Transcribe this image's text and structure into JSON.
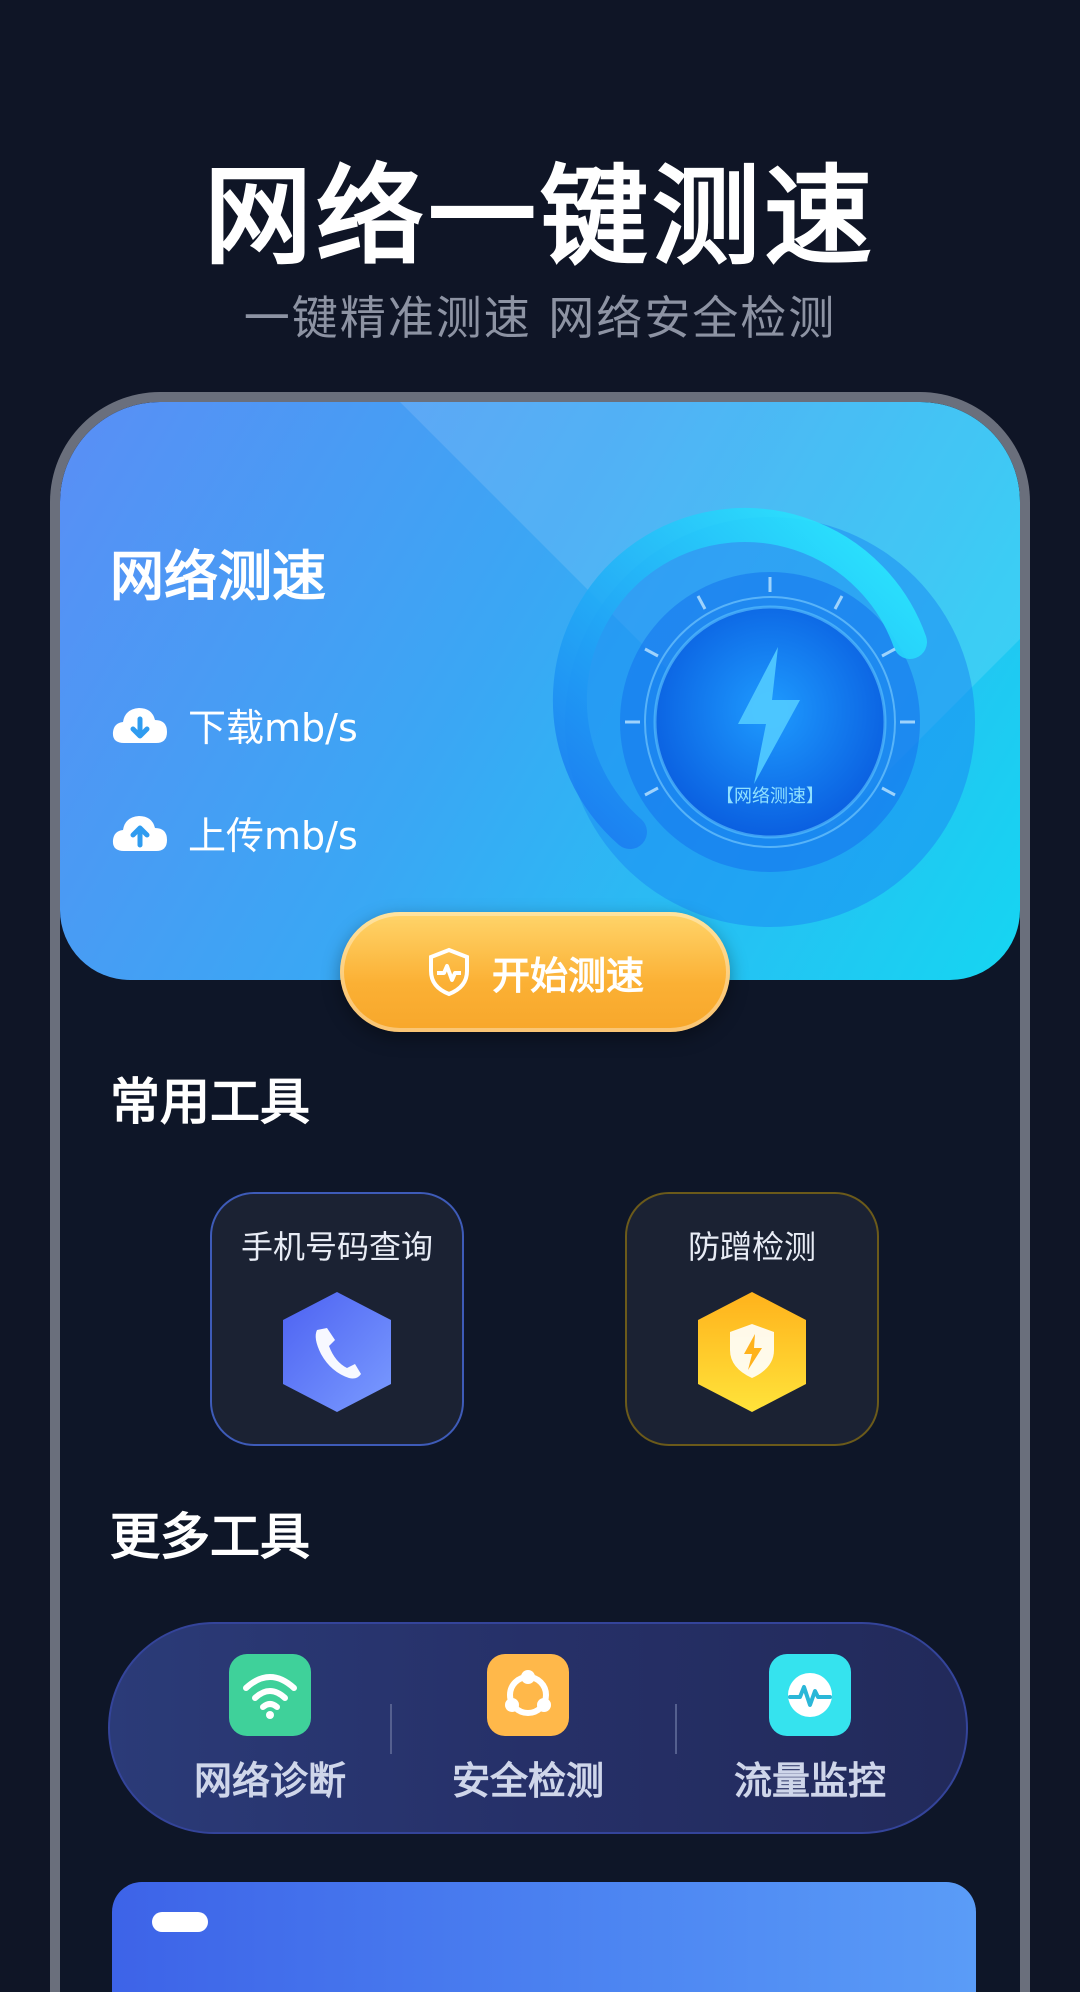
{
  "hero": {
    "title": "网络一键测速",
    "subtitle": "一键精准测速  网络安全检测"
  },
  "speed_card": {
    "title": "网络测速",
    "download_label": "下载mb/s",
    "upload_label": "上传mb/s",
    "gauge_caption": "【网络测速】",
    "start_button": "开始测速"
  },
  "common_tools": {
    "title": "常用工具",
    "items": [
      {
        "label": "手机号码查询",
        "icon": "phone-icon",
        "color": "#5a7bff"
      },
      {
        "label": "防蹭检测",
        "icon": "shield-bolt-icon",
        "color": "#ffc21a"
      }
    ]
  },
  "more_tools": {
    "title": "更多工具",
    "items": [
      {
        "label": "网络诊断",
        "icon": "wifi-icon",
        "color": "#3fd19a"
      },
      {
        "label": "安全检测",
        "icon": "security-icon",
        "color": "#ffb84a"
      },
      {
        "label": "流量监控",
        "icon": "pulse-icon",
        "color": "#35e3ee"
      }
    ]
  },
  "colors": {
    "background": "#0f1526",
    "accent_blue": "#15d6f2",
    "accent_orange": "#fbb034"
  }
}
